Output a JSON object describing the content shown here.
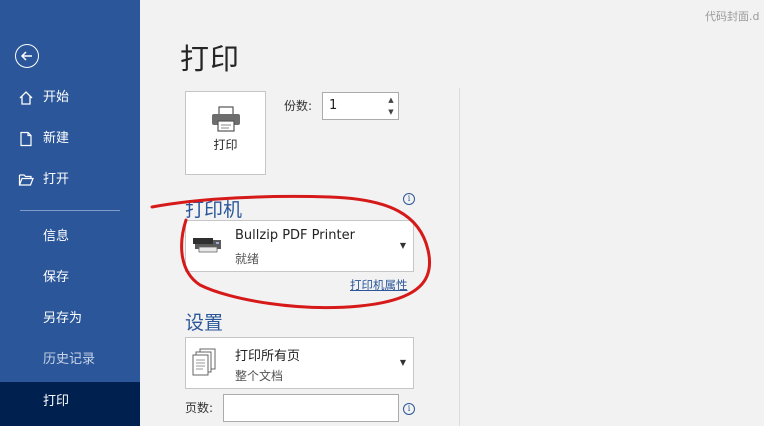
{
  "document_title": "代码封面.d",
  "sidebar": {
    "items": [
      {
        "label": "开始",
        "icon": "home-icon"
      },
      {
        "label": "新建",
        "icon": "new-document-icon"
      },
      {
        "label": "打开",
        "icon": "open-folder-icon"
      },
      {
        "label": "信息"
      },
      {
        "label": "保存"
      },
      {
        "label": "另存为"
      },
      {
        "label": "历史记录"
      },
      {
        "label": "打印"
      }
    ],
    "active": "打印",
    "back_icon": "back-arrow-icon"
  },
  "page": {
    "title": "打印"
  },
  "print_button": {
    "label": "打印",
    "icon": "printer-icon"
  },
  "copies": {
    "label": "份数:",
    "value": "1"
  },
  "printer": {
    "heading": "打印机",
    "name": "Bullzip PDF Printer",
    "status": "就绪",
    "properties_link": "打印机属性"
  },
  "settings": {
    "heading": "设置",
    "range_title": "打印所有页",
    "range_subtitle": "整个文档",
    "pages_label": "页数:",
    "pages_value": ""
  },
  "colors": {
    "sidebar_bg": "#2b579a",
    "sidebar_active": "#002050",
    "accent": "#2b579a",
    "annotation": "#d61a1a"
  }
}
